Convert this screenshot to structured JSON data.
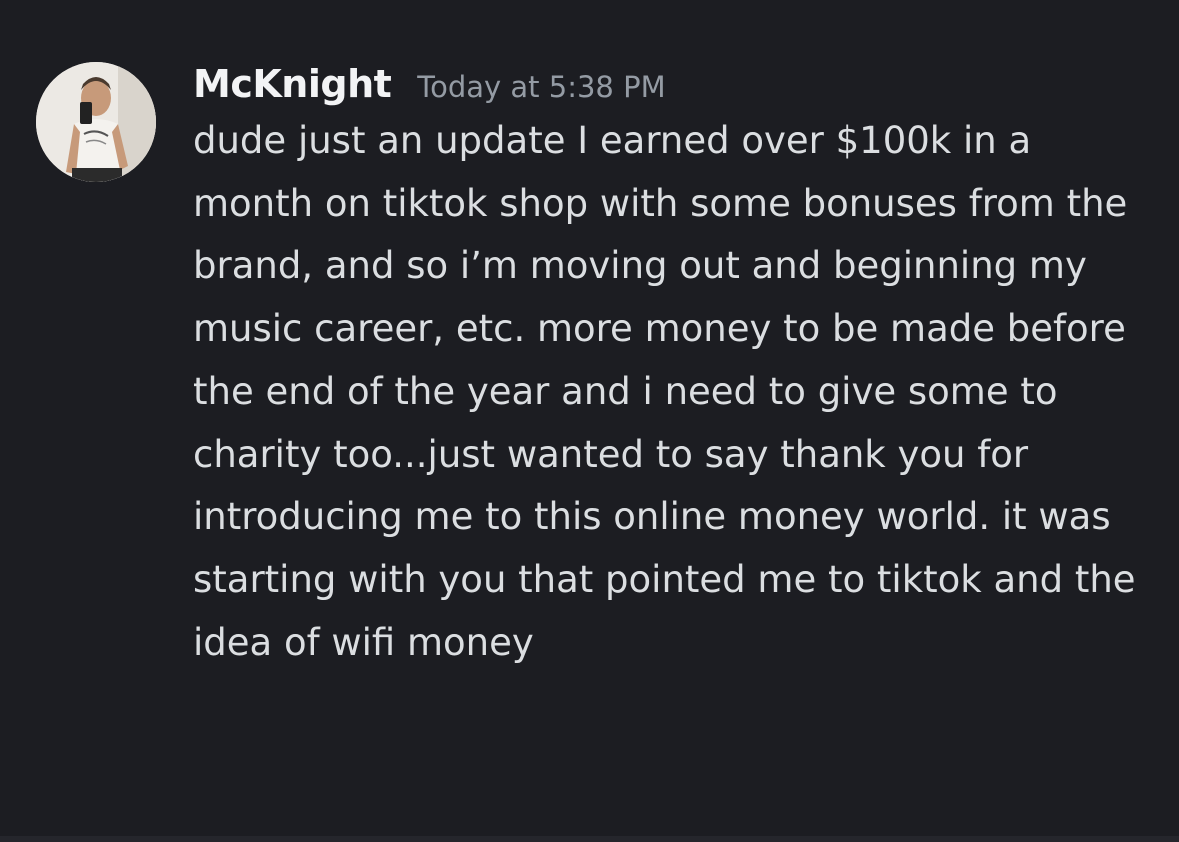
{
  "message": {
    "username": "McKnight",
    "timestamp": "Today at 5:38 PM",
    "avatar_icon": "user-avatar-photo",
    "text": "dude just an update I earned over $100k in a month on tiktok shop with some bonuses from the brand, and so i’m moving out and beginning my music career, etc. more money to be made before the end of the year and i need to give some to charity too...just wanted to say thank you for introducing me to this online money world. it was starting with you that pointed me to tiktok and the idea of wifi money"
  },
  "colors": {
    "background": "#1c1d22",
    "username": "#f2f3f5",
    "timestamp": "#949ba4",
    "body_text": "#dbdee1"
  }
}
